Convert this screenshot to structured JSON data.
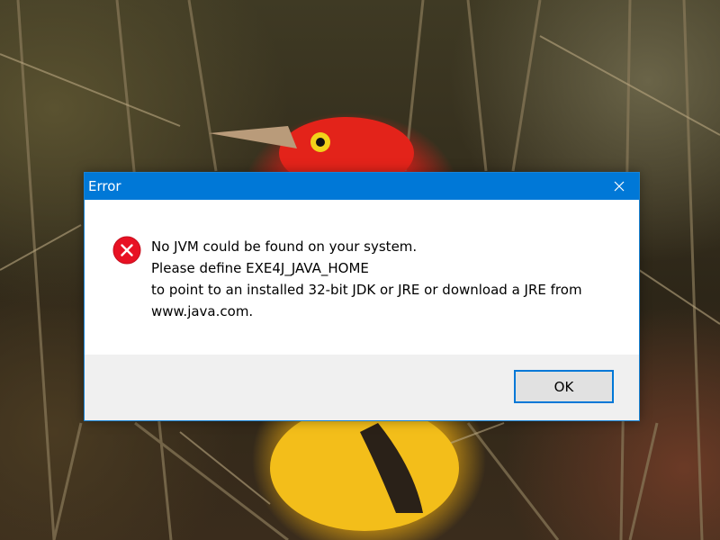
{
  "dialog": {
    "title": "Error",
    "close_icon": "close-icon",
    "error_icon": "error-icon",
    "message_lines": [
      "No JVM could be found on your system.",
      "Please define EXE4J_JAVA_HOME",
      "to point to an installed 32-bit JDK or JRE or download a JRE from",
      "www.java.com."
    ],
    "ok_label": "OK"
  },
  "colors": {
    "titlebar": "#0078d7",
    "error_red": "#e81123",
    "footer": "#f0f0f0"
  }
}
